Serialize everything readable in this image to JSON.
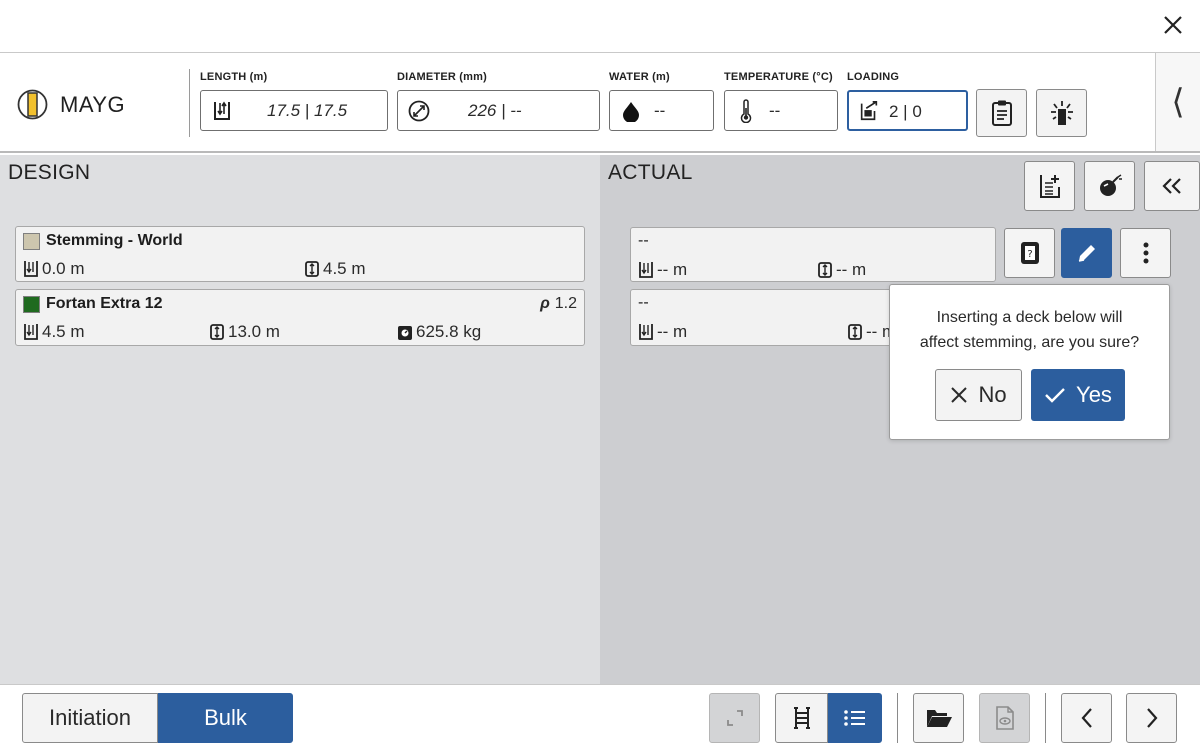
{
  "window": {
    "close_icon": "close-icon"
  },
  "header": {
    "hole_name": "MAYG",
    "fields": {
      "length": {
        "label": "LENGTH (m)",
        "value": "17.5 | 17.5"
      },
      "diameter": {
        "label": "DIAMETER (mm)",
        "value": "226 | --"
      },
      "water": {
        "label": "WATER (m)",
        "value": "--"
      },
      "temperature": {
        "label": "TEMPERATURE (°C)",
        "value": "--"
      },
      "loading": {
        "label": "LOADING",
        "value": "2 | 0"
      }
    },
    "collapse_glyph": "⟨"
  },
  "design": {
    "title": "DESIGN",
    "decks": [
      {
        "name": "Stemming - World",
        "color": "#cdc6ae",
        "top": "0.0 m",
        "length": "4.5 m"
      },
      {
        "name": "Fortan Extra 12",
        "color": "#1f6a1f",
        "rho_symbol": "ρ",
        "rho": "1.2",
        "top": "4.5 m",
        "length": "13.0 m",
        "weight": "625.8 kg"
      }
    ]
  },
  "actual": {
    "title": "ACTUAL",
    "decks": [
      {
        "name": "--",
        "top": "-- m",
        "length": "-- m"
      },
      {
        "name": "--",
        "top": "-- m",
        "length": "-- m"
      }
    ]
  },
  "popover": {
    "message_line1": "Inserting a deck below will",
    "message_line2": "affect stemming, are you sure?",
    "no_label": "No",
    "yes_label": "Yes"
  },
  "footer": {
    "mode_tabs": [
      "Initiation",
      "Bulk"
    ],
    "active_mode": "Bulk"
  },
  "colors": {
    "accent": "#2c5e9e",
    "design_bg": "#dedfe1",
    "actual_bg": "#cdced1"
  }
}
